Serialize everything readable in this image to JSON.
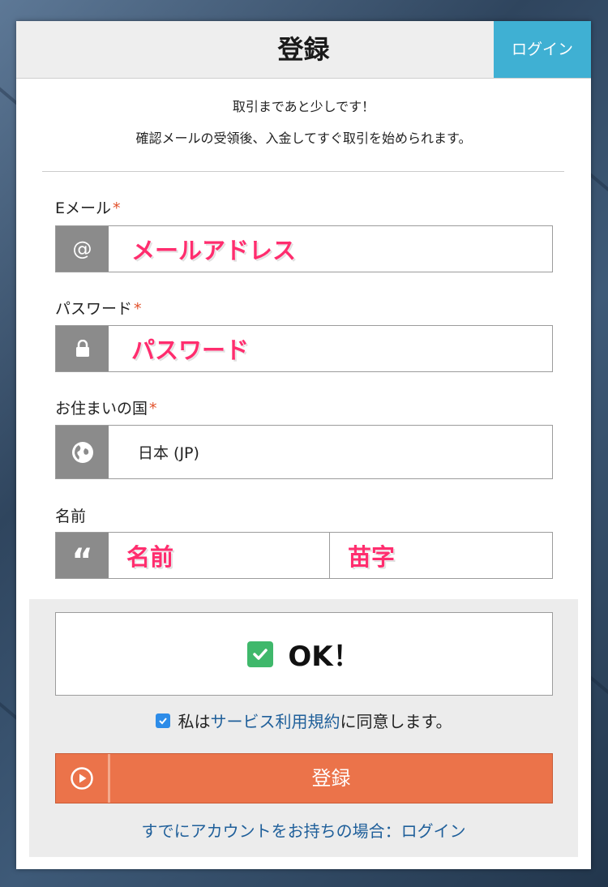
{
  "header": {
    "title": "登録",
    "login_tab": "ログイン"
  },
  "intro": {
    "line1": "取引まであと少しです！",
    "line2": "確認メールの受領後、入金してすぐ取引を始められます。"
  },
  "fields": {
    "email": {
      "label": "Eメール",
      "required_mark": "*",
      "value": "メールアドレス",
      "icon": "at-icon"
    },
    "password": {
      "label": "パスワード",
      "required_mark": "*",
      "value": "パスワード",
      "icon": "lock-icon"
    },
    "country": {
      "label": "お住まいの国",
      "required_mark": "*",
      "value": "日本 (JP)",
      "icon": "globe-icon"
    },
    "name": {
      "label": "名前",
      "first": "名前",
      "last": "苗字",
      "icon": "quote-icon"
    }
  },
  "captcha": {
    "text": "OK！",
    "checked": true
  },
  "terms": {
    "prefix": "私は",
    "link": "サービス利用規約",
    "suffix": "に同意します。",
    "checked": true
  },
  "register_button": {
    "label": "登録",
    "icon": "play-circle-icon"
  },
  "footer": {
    "text": "すでにアカウントをお持ちの場合：",
    "link": "ログイン"
  },
  "colors": {
    "accent_blue": "#3fb0d3",
    "register_orange": "#eb734a",
    "highlight_pink": "#ff2d6e",
    "link_blue": "#1f5f9a"
  }
}
